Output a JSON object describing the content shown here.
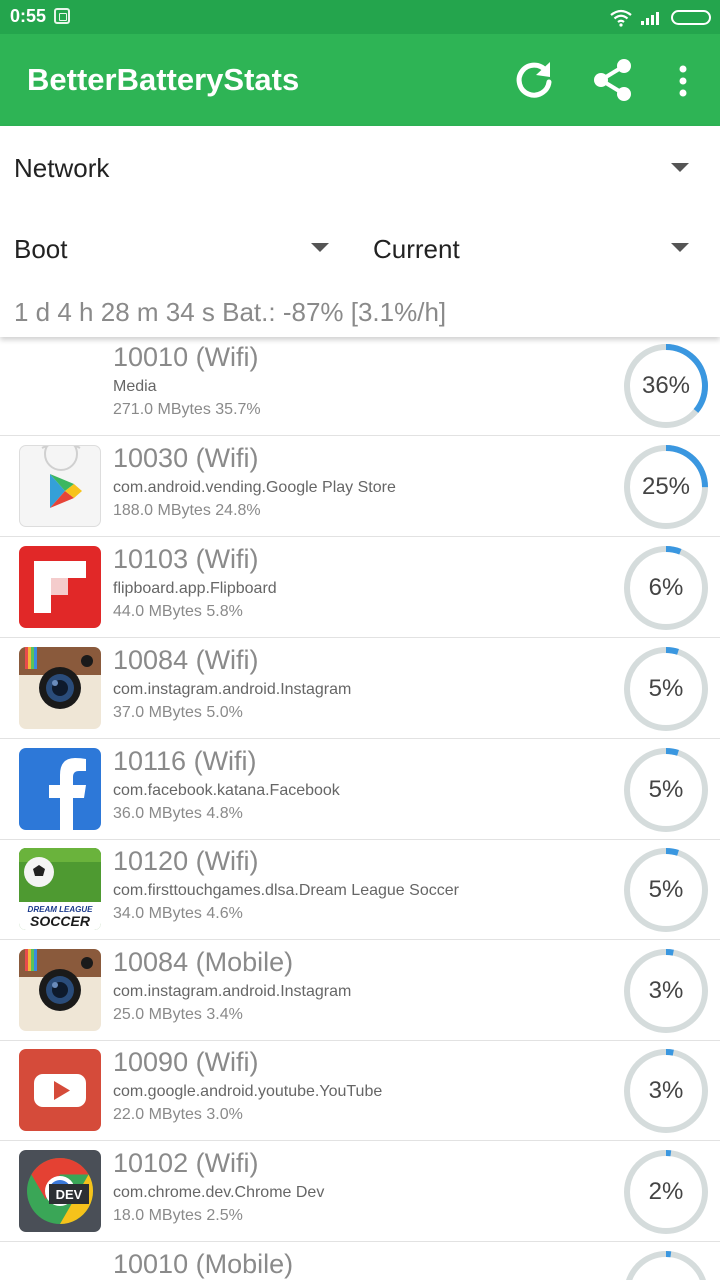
{
  "status_bar": {
    "time": "0:55"
  },
  "app_bar": {
    "title": "BetterBatteryStats"
  },
  "filters": {
    "category": "Network",
    "from": "Boot",
    "to": "Current",
    "summary": "1 d 4 h 28 m 34 s  Bat.: -87% [3.1%/h]"
  },
  "colors": {
    "status_bar": "#24a54d",
    "app_bar": "#2eb455",
    "gauge_fill": "#3a97e0",
    "gauge_track": "#d5dcdc"
  },
  "items": [
    {
      "uid": "10010 (Wifi)",
      "package": "Media",
      "usage": "271.0 MBytes 35.7%",
      "percent_label": "36%",
      "percent": 36,
      "icon": "none"
    },
    {
      "uid": "10030 (Wifi)",
      "package": "com.android.vending.Google Play Store",
      "usage": "188.0 MBytes 24.8%",
      "percent_label": "25%",
      "percent": 25,
      "icon": "play-store-icon"
    },
    {
      "uid": "10103 (Wifi)",
      "package": "flipboard.app.Flipboard",
      "usage": "44.0 MBytes 5.8%",
      "percent_label": "6%",
      "percent": 6,
      "icon": "flipboard-icon"
    },
    {
      "uid": "10084 (Wifi)",
      "package": "com.instagram.android.Instagram",
      "usage": "37.0 MBytes 5.0%",
      "percent_label": "5%",
      "percent": 5,
      "icon": "instagram-icon"
    },
    {
      "uid": "10116 (Wifi)",
      "package": "com.facebook.katana.Facebook",
      "usage": "36.0 MBytes 4.8%",
      "percent_label": "5%",
      "percent": 5,
      "icon": "facebook-icon"
    },
    {
      "uid": "10120 (Wifi)",
      "package": "com.firsttouchgames.dlsa.Dream League Soccer",
      "usage": "34.0 MBytes 4.6%",
      "percent_label": "5%",
      "percent": 5,
      "icon": "dream-league-soccer-icon",
      "icon_text_top": "DREAM LEAGUE",
      "icon_text_bottom": "SOCCER"
    },
    {
      "uid": "10084 (Mobile)",
      "package": "com.instagram.android.Instagram",
      "usage": "25.0 MBytes 3.4%",
      "percent_label": "3%",
      "percent": 3,
      "icon": "instagram-icon"
    },
    {
      "uid": "10090 (Wifi)",
      "package": "com.google.android.youtube.YouTube",
      "usage": "22.0 MBytes 3.0%",
      "percent_label": "3%",
      "percent": 3,
      "icon": "youtube-icon"
    },
    {
      "uid": "10102 (Wifi)",
      "package": "com.chrome.dev.Chrome Dev",
      "usage": "18.0 MBytes 2.5%",
      "percent_label": "2%",
      "percent": 2,
      "icon": "chrome-dev-icon",
      "icon_text": "DEV"
    },
    {
      "uid": "10010 (Mobile)",
      "package": "",
      "usage": "",
      "percent_label": "",
      "percent": 2,
      "icon": "none"
    }
  ]
}
